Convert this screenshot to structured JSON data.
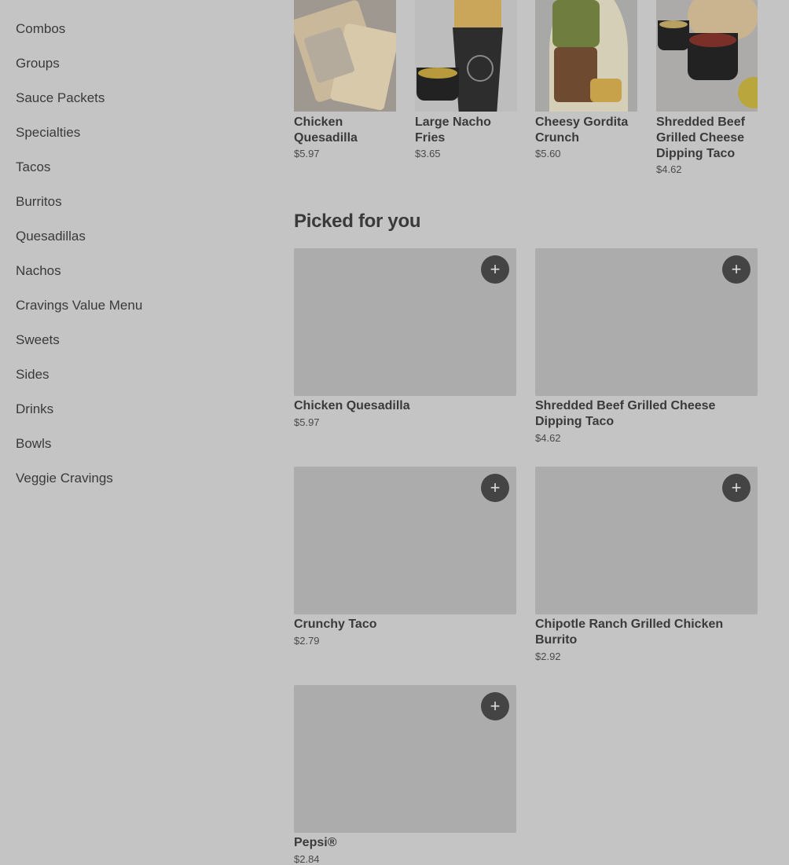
{
  "sidebar": {
    "items": [
      {
        "label": "Combos"
      },
      {
        "label": "Groups"
      },
      {
        "label": "Sauce Packets"
      },
      {
        "label": "Specialties"
      },
      {
        "label": "Tacos"
      },
      {
        "label": "Burritos"
      },
      {
        "label": "Quesadillas"
      },
      {
        "label": "Nachos"
      },
      {
        "label": "Cravings Value Menu"
      },
      {
        "label": "Sweets"
      },
      {
        "label": "Sides"
      },
      {
        "label": "Drinks"
      },
      {
        "label": "Bowls"
      },
      {
        "label": "Veggie Cravings"
      }
    ]
  },
  "featured": {
    "items": [
      {
        "name": "Chicken Quesadilla",
        "price": "$5.97"
      },
      {
        "name": "Large Nacho Fries",
        "price": "$3.65"
      },
      {
        "name": "Cheesy Gordita Crunch",
        "price": "$5.60"
      },
      {
        "name": "Shredded Beef Grilled Cheese Dipping Taco",
        "price": "$4.62"
      }
    ]
  },
  "picked": {
    "title": "Picked for you",
    "add_label": "+",
    "items": [
      {
        "name": "Chicken Quesadilla",
        "price": "$5.97"
      },
      {
        "name": "Shredded Beef Grilled Cheese Dipping Taco",
        "price": "$4.62"
      },
      {
        "name": "Crunchy Taco",
        "price": "$2.79"
      },
      {
        "name": "Chipotle Ranch Grilled Chicken Burrito",
        "price": "$2.92"
      },
      {
        "name": "Pepsi®",
        "price": "$2.84"
      }
    ]
  }
}
